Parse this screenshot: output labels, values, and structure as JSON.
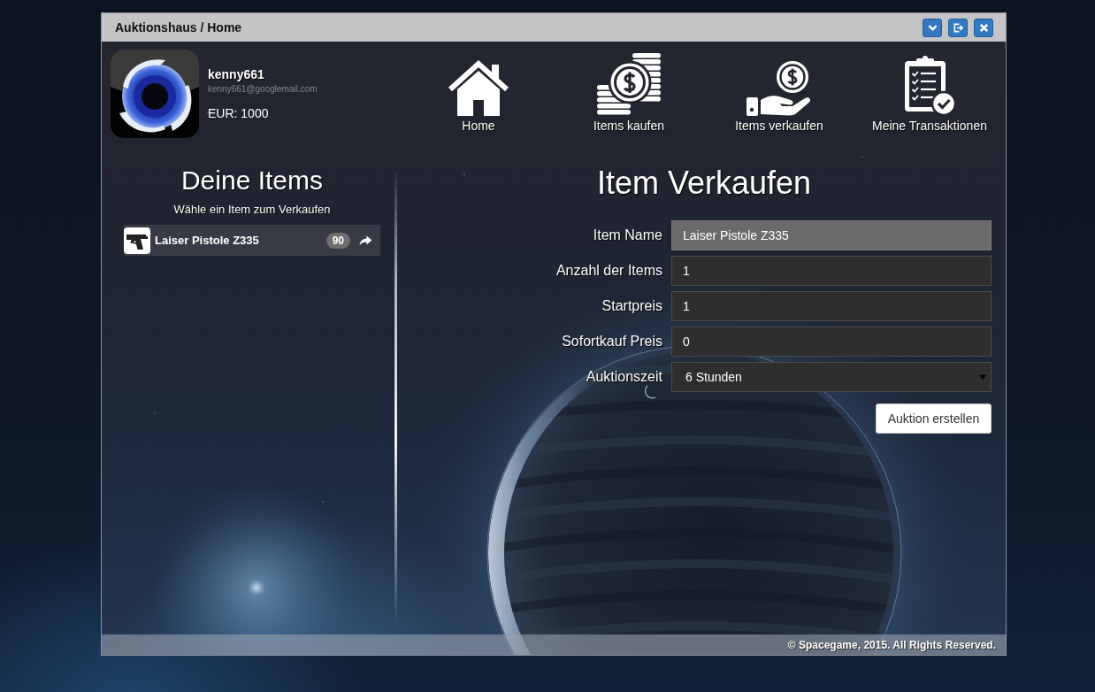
{
  "window": {
    "title": "Auktionshaus / Home",
    "controls": [
      {
        "kind": "collapse"
      },
      {
        "kind": "logout"
      },
      {
        "kind": "close"
      }
    ]
  },
  "user": {
    "name": "kenny661",
    "email": "kenny661@googlemail.com",
    "balance": "EUR: 1000"
  },
  "nav": [
    {
      "kind": "home",
      "label": "Home"
    },
    {
      "kind": "buy",
      "label": "Items kaufen"
    },
    {
      "kind": "sell",
      "label": "Items verkaufen"
    },
    {
      "kind": "transactions",
      "label": "Meine Transaktionen"
    }
  ],
  "inventory": {
    "title": "Deine Items",
    "subtitle": "Wähle ein Item zum Verkaufen",
    "items": [
      {
        "name": "Laiser Pistole Z335",
        "count": "90"
      }
    ]
  },
  "sell_form": {
    "title": "Item Verkaufen",
    "fields": [
      {
        "kind": "text",
        "label": "Item Name",
        "value": "Laiser Pistole Z335",
        "disabled": true
      },
      {
        "kind": "text",
        "label": "Anzahl der Items",
        "value": "1",
        "disabled": false
      },
      {
        "kind": "text",
        "label": "Startpreis",
        "value": "1",
        "disabled": false
      },
      {
        "kind": "text",
        "label": "Sofortkauf Preis",
        "value": "0",
        "disabled": false
      },
      {
        "kind": "select",
        "label": "Auktionszeit",
        "value": "6 Stunden",
        "disabled": false
      }
    ],
    "submit": "Auktion erstellen"
  },
  "footer": {
    "text": "© Spacegame, 2015. All Rights Reserved."
  }
}
